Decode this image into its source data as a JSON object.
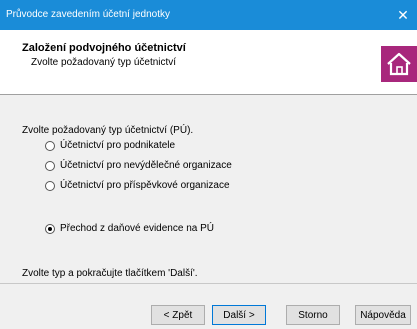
{
  "window": {
    "title": "Průvodce zavedením účetní jednotky",
    "close_glyph": "✕"
  },
  "header": {
    "title": "Založení podvojného účetnictví",
    "subtitle": "Zvolte požadovaný typ účetnictví",
    "logo_icon": "home-icon",
    "logo_color": "#a8277c"
  },
  "content": {
    "prompt": "Zvolte požadovaný typ účetnictví (PÚ).",
    "options": [
      {
        "label": "Účetnictví pro podnikatele",
        "selected": false
      },
      {
        "label": "Účetnictví pro nevýdělečné organizace",
        "selected": false
      },
      {
        "label": "Účetnictví pro příspěvkové organizace",
        "selected": false
      },
      {
        "label": "Přechod z daňové evidence na PÚ",
        "selected": true
      }
    ],
    "hint": "Zvolte typ a pokračujte tlačítkem 'Další'."
  },
  "buttons": {
    "back": "< Zpět",
    "next": "Další >",
    "cancel": "Storno",
    "help": "Nápověda"
  },
  "colors": {
    "titlebar": "#1a8cd8",
    "accent": "#0078d7"
  }
}
